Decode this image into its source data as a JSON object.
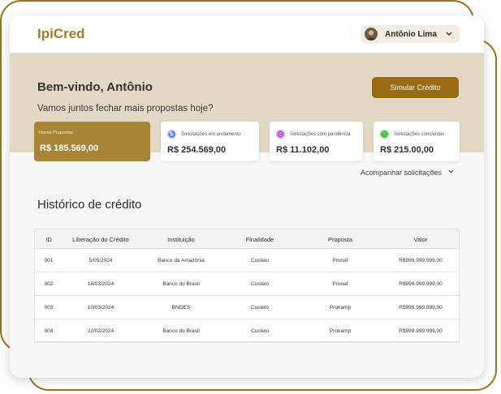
{
  "app": {
    "brand": "IpiCred"
  },
  "user": {
    "name": "Antônio Lima"
  },
  "hero": {
    "welcome": "Bem-vindo, Antônio",
    "subtitle": "Vamos juntos fechar mais propostas hoje?",
    "cta_label": "Simular Crédito"
  },
  "stats": [
    {
      "label": "Novas Propostas",
      "value": "R$ 185.569,00",
      "icon": "",
      "color": "#a88536"
    },
    {
      "label": "Solicitações em andamento",
      "value": "R$ 254.569,00",
      "icon": "progress-icon",
      "color": "#8fa8e8"
    },
    {
      "label": "Solicitações com pendencia",
      "value": "R$ 11.102,00",
      "icon": "pending-icon",
      "color": "#d08be0"
    },
    {
      "label": "Solicitações concluídas",
      "value": "R$ 215.00,00",
      "icon": "check-icon",
      "color": "#7fd67a"
    }
  ],
  "track_link": "Acompanhar solicitações",
  "history": {
    "title": "Histórico de crédito",
    "columns": [
      "ID",
      "Liberação do Crédito",
      "Instituição",
      "Finalidade",
      "Proposta",
      "Valor"
    ],
    "rows": [
      [
        "001",
        "5/05/2024",
        "Banco da Amazônia",
        "Custeio",
        "Pronaf",
        "R$999.999.999,00"
      ],
      [
        "002",
        "18/03/2024",
        "Banco do Brasil",
        "Custeio",
        "Pronaf",
        "R$999.999.999,00"
      ],
      [
        "003",
        "10/03/2024",
        "BNDES",
        "Custeio",
        "Pronamp",
        "R$999.999.999,00"
      ],
      [
        "004",
        "22/02/2024",
        "Banco do Brasil",
        "Custeio",
        "Pronamp",
        "R$999.999.999,00"
      ]
    ]
  }
}
